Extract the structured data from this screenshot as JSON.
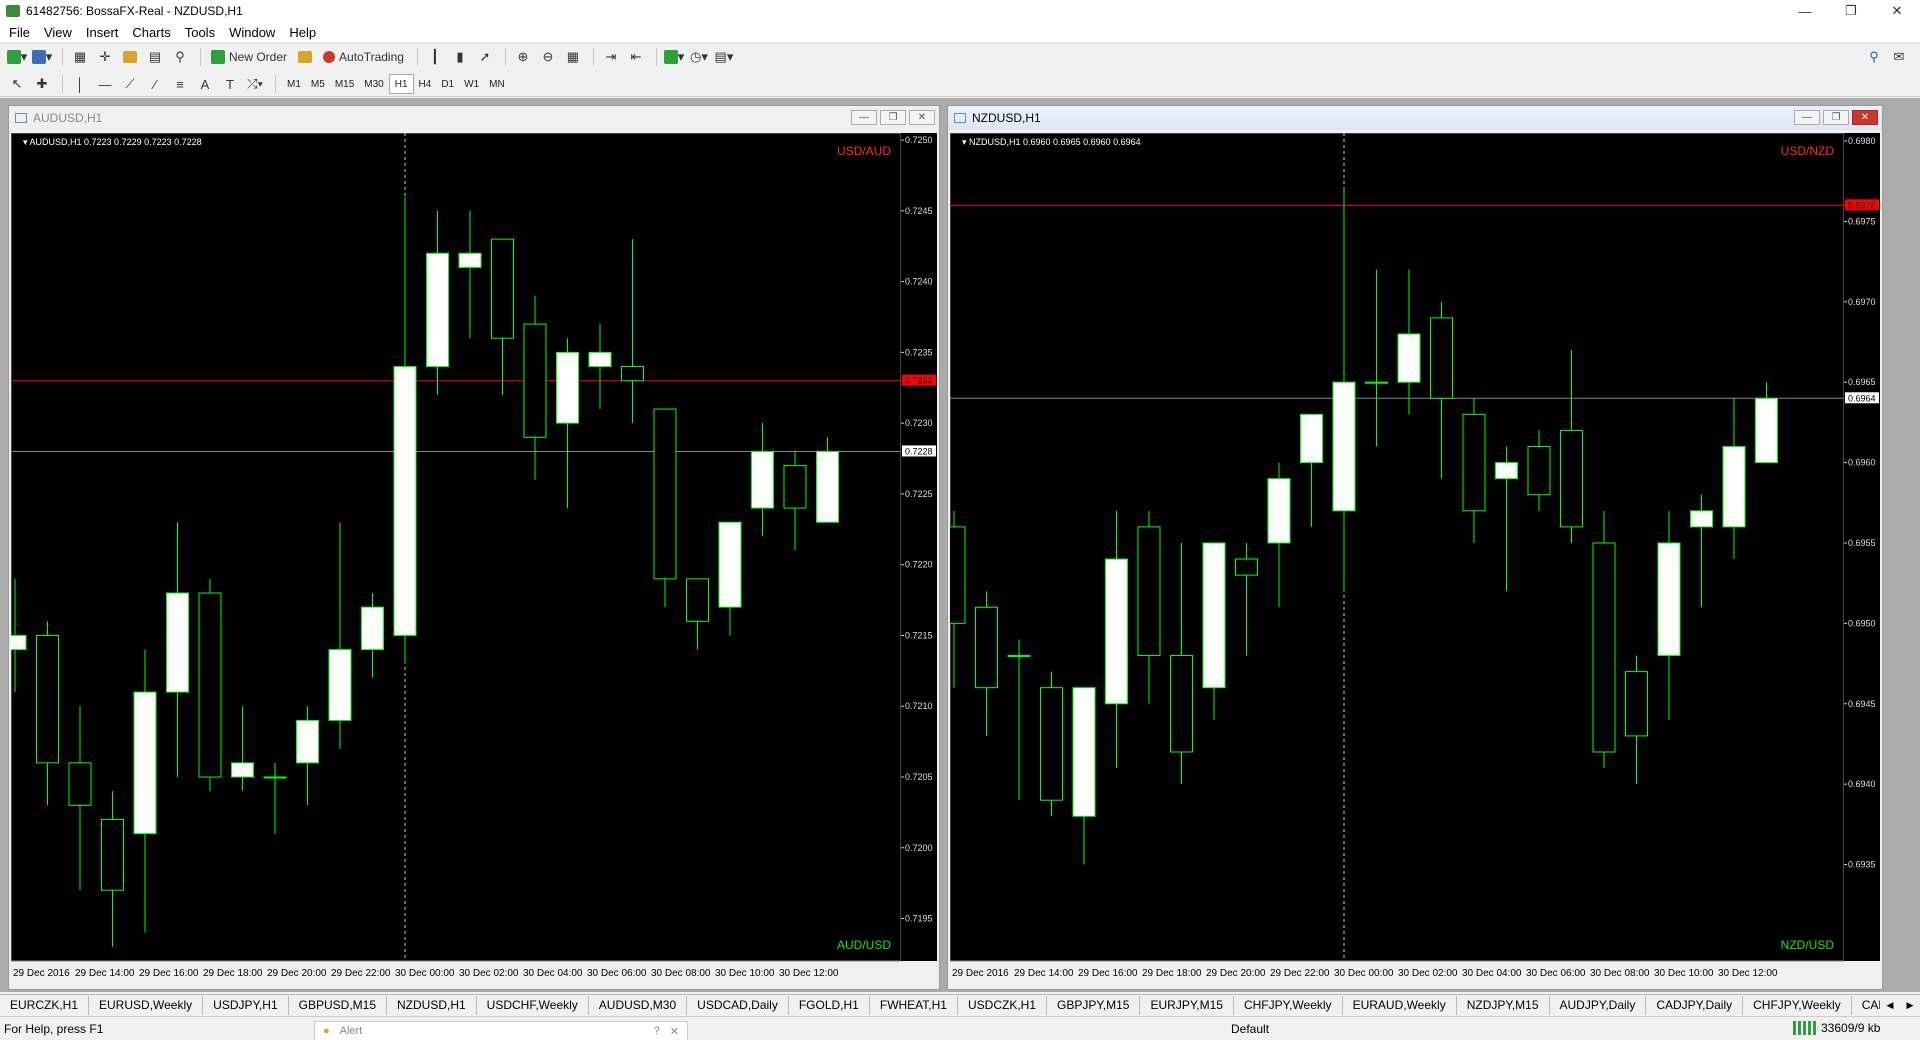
{
  "window": {
    "title": "61482756: BossaFX-Real - NZDUSD,H1"
  },
  "menu": [
    "File",
    "View",
    "Insert",
    "Charts",
    "Tools",
    "Window",
    "Help"
  ],
  "toolbar": {
    "new_order": "New Order",
    "autotrading": "AutoTrading"
  },
  "timeframes": [
    "M1",
    "M5",
    "M15",
    "M30",
    "H1",
    "H4",
    "D1",
    "W1",
    "MN"
  ],
  "active_timeframe": "H1",
  "charts": [
    {
      "window_title": "AUDUSD,H1",
      "active": false,
      "info": "AUDUSD,H1  0.7223 0.7229 0.7223 0.7228",
      "label_top": "USD/AUD",
      "label_bottom": "AUD/USD",
      "price_range": [
        0.7192,
        0.72505
      ],
      "ticks": [
        "0.7250",
        "0.7245",
        "0.7240",
        "0.7235",
        "0.7230",
        "0.7225",
        "0.7220",
        "0.7215",
        "0.7210",
        "0.7205",
        "0.7200",
        "0.7195"
      ],
      "tick_values": [
        0.725,
        0.7245,
        0.724,
        0.7235,
        0.723,
        0.7225,
        0.722,
        0.7215,
        0.721,
        0.7205,
        0.72,
        0.7195
      ],
      "red_line": {
        "value": 0.7233,
        "label": "0.7233"
      },
      "bid_line": {
        "value": 0.7228,
        "label": "0.7228"
      },
      "x_labels": [
        "29 Dec 2016",
        "29 Dec 14:00",
        "29 Dec 16:00",
        "29 Dec 18:00",
        "29 Dec 20:00",
        "29 Dec 22:00",
        "30 Dec 00:00",
        "30 Dec 02:00",
        "30 Dec 04:00",
        "30 Dec 06:00",
        "30 Dec 08:00",
        "30 Dec 10:00",
        "30 Dec 12:00"
      ],
      "separator_index": 12,
      "candles": [
        [
          0.7214,
          0.7219,
          0.7211,
          0.7215
        ],
        [
          0.7215,
          0.7216,
          0.7203,
          0.7206
        ],
        [
          0.7206,
          0.721,
          0.7197,
          0.7203
        ],
        [
          0.7202,
          0.7204,
          0.7193,
          0.7197
        ],
        [
          0.7201,
          0.7214,
          0.7194,
          0.7211
        ],
        [
          0.7211,
          0.7223,
          0.7205,
          0.7218
        ],
        [
          0.7218,
          0.7219,
          0.7204,
          0.7205
        ],
        [
          0.7205,
          0.721,
          0.7204,
          0.7206
        ],
        [
          0.7205,
          0.7206,
          0.7201,
          0.7205
        ],
        [
          0.7206,
          0.721,
          0.7203,
          0.7209
        ],
        [
          0.7209,
          0.7223,
          0.7207,
          0.7214
        ],
        [
          0.7214,
          0.7218,
          0.7212,
          0.7217
        ],
        [
          0.7215,
          0.7246,
          0.7213,
          0.7234
        ],
        [
          0.7234,
          0.7245,
          0.7232,
          0.7242
        ],
        [
          0.7241,
          0.7245,
          0.7236,
          0.7242
        ],
        [
          0.7243,
          0.7243,
          0.7232,
          0.7236
        ],
        [
          0.7237,
          0.7239,
          0.7226,
          0.7229
        ],
        [
          0.723,
          0.7236,
          0.7224,
          0.7235
        ],
        [
          0.7234,
          0.7237,
          0.7231,
          0.7235
        ],
        [
          0.7234,
          0.7243,
          0.723,
          0.7233
        ],
        [
          0.7231,
          0.7231,
          0.7217,
          0.7219
        ],
        [
          0.7219,
          0.7219,
          0.7214,
          0.7216
        ],
        [
          0.7217,
          0.7223,
          0.7215,
          0.7223
        ],
        [
          0.7224,
          0.723,
          0.7222,
          0.7228
        ],
        [
          0.7227,
          0.7228,
          0.7221,
          0.7224
        ],
        [
          0.7223,
          0.7229,
          0.7223,
          0.7228
        ]
      ]
    },
    {
      "window_title": "NZDUSD,H1",
      "active": true,
      "info": "NZDUSD,H1  0.6960 0.6965 0.6960 0.6964",
      "label_top": "USD/NZD",
      "label_bottom": "NZD/USD",
      "price_range": [
        0.6929,
        0.69805
      ],
      "ticks": [
        "0.6980",
        "0.6975",
        "0.6970",
        "0.6965",
        "0.6960",
        "0.6955",
        "0.6950",
        "0.6945",
        "0.6940",
        "0.6935"
      ],
      "tick_values": [
        0.698,
        0.6975,
        0.697,
        0.6965,
        0.696,
        0.6955,
        0.695,
        0.6945,
        0.694,
        0.6935
      ],
      "red_line": {
        "value": 0.6976,
        "label": "0.6976"
      },
      "bid_line": {
        "value": 0.6964,
        "label": "0.6964"
      },
      "x_labels": [
        "29 Dec 2016",
        "29 Dec 14:00",
        "29 Dec 16:00",
        "29 Dec 18:00",
        "29 Dec 20:00",
        "29 Dec 22:00",
        "30 Dec 00:00",
        "30 Dec 02:00",
        "30 Dec 04:00",
        "30 Dec 06:00",
        "30 Dec 08:00",
        "30 Dec 10:00",
        "30 Dec 12:00"
      ],
      "separator_index": 12,
      "candles": [
        [
          0.6956,
          0.6957,
          0.6946,
          0.695
        ],
        [
          0.6951,
          0.6952,
          0.6943,
          0.6946
        ],
        [
          0.6948,
          0.6949,
          0.6939,
          0.6948
        ],
        [
          0.6946,
          0.6947,
          0.6938,
          0.6939
        ],
        [
          0.6938,
          0.6946,
          0.6935,
          0.6946
        ],
        [
          0.6945,
          0.6957,
          0.6941,
          0.6954
        ],
        [
          0.6956,
          0.6957,
          0.6945,
          0.6948
        ],
        [
          0.6948,
          0.6955,
          0.694,
          0.6942
        ],
        [
          0.6946,
          0.6955,
          0.6944,
          0.6955
        ],
        [
          0.6954,
          0.6955,
          0.6948,
          0.6953
        ],
        [
          0.6955,
          0.696,
          0.6951,
          0.6959
        ],
        [
          0.696,
          0.6963,
          0.6956,
          0.6963
        ],
        [
          0.6957,
          0.6977,
          0.6952,
          0.6965
        ],
        [
          0.6965,
          0.6972,
          0.6961,
          0.6965
        ],
        [
          0.6965,
          0.6972,
          0.6963,
          0.6968
        ],
        [
          0.6969,
          0.697,
          0.6959,
          0.6964
        ],
        [
          0.6963,
          0.6964,
          0.6955,
          0.6957
        ],
        [
          0.6959,
          0.6961,
          0.6952,
          0.696
        ],
        [
          0.6961,
          0.6962,
          0.6957,
          0.6958
        ],
        [
          0.6962,
          0.6967,
          0.6955,
          0.6956
        ],
        [
          0.6955,
          0.6957,
          0.6941,
          0.6942
        ],
        [
          0.6947,
          0.6948,
          0.694,
          0.6943
        ],
        [
          0.6948,
          0.6957,
          0.6944,
          0.6955
        ],
        [
          0.6956,
          0.6958,
          0.6951,
          0.6957
        ],
        [
          0.6956,
          0.6964,
          0.6954,
          0.6961
        ],
        [
          0.696,
          0.6965,
          0.696,
          0.6964
        ]
      ]
    }
  ],
  "tabs": [
    "EURCZK,H1",
    "EURUSD,Weekly",
    "USDJPY,H1",
    "GBPUSD,M15",
    "NZDUSD,H1",
    "USDCHF,Weekly",
    "AUDUSD,M30",
    "USDCAD,Daily",
    "FGOLD,H1",
    "FWHEAT,H1",
    "USDCZK,H1",
    "GBPJPY,M15",
    "EURJPY,M15",
    "CHFJPY,Weekly",
    "EURAUD,Weekly",
    "NZDJPY,M15",
    "AUDJPY,Daily",
    "CADJPY,Daily",
    "CHFJPY,Weekly",
    "CADCHF,Weekly"
  ],
  "status": {
    "help": "For Help, press F1",
    "alert": "Alert",
    "profile": "Default",
    "traffic": "33609/9 kb"
  },
  "colors": {
    "bull_candle": "#ffffff",
    "wick": "#00ff00",
    "red_line": "#ff0000",
    "bid_line": "#778899",
    "chart_bg": "#000000"
  },
  "chart_data": [
    {
      "type": "candlestick",
      "symbol": "AUDUSD",
      "timeframe": "H1",
      "ohlc_source": "charts.0.candles",
      "ylim": [
        0.7195,
        0.725
      ]
    },
    {
      "type": "candlestick",
      "symbol": "NZDUSD",
      "timeframe": "H1",
      "ohlc_source": "charts.1.candles",
      "ylim": [
        0.6935,
        0.698
      ]
    }
  ]
}
